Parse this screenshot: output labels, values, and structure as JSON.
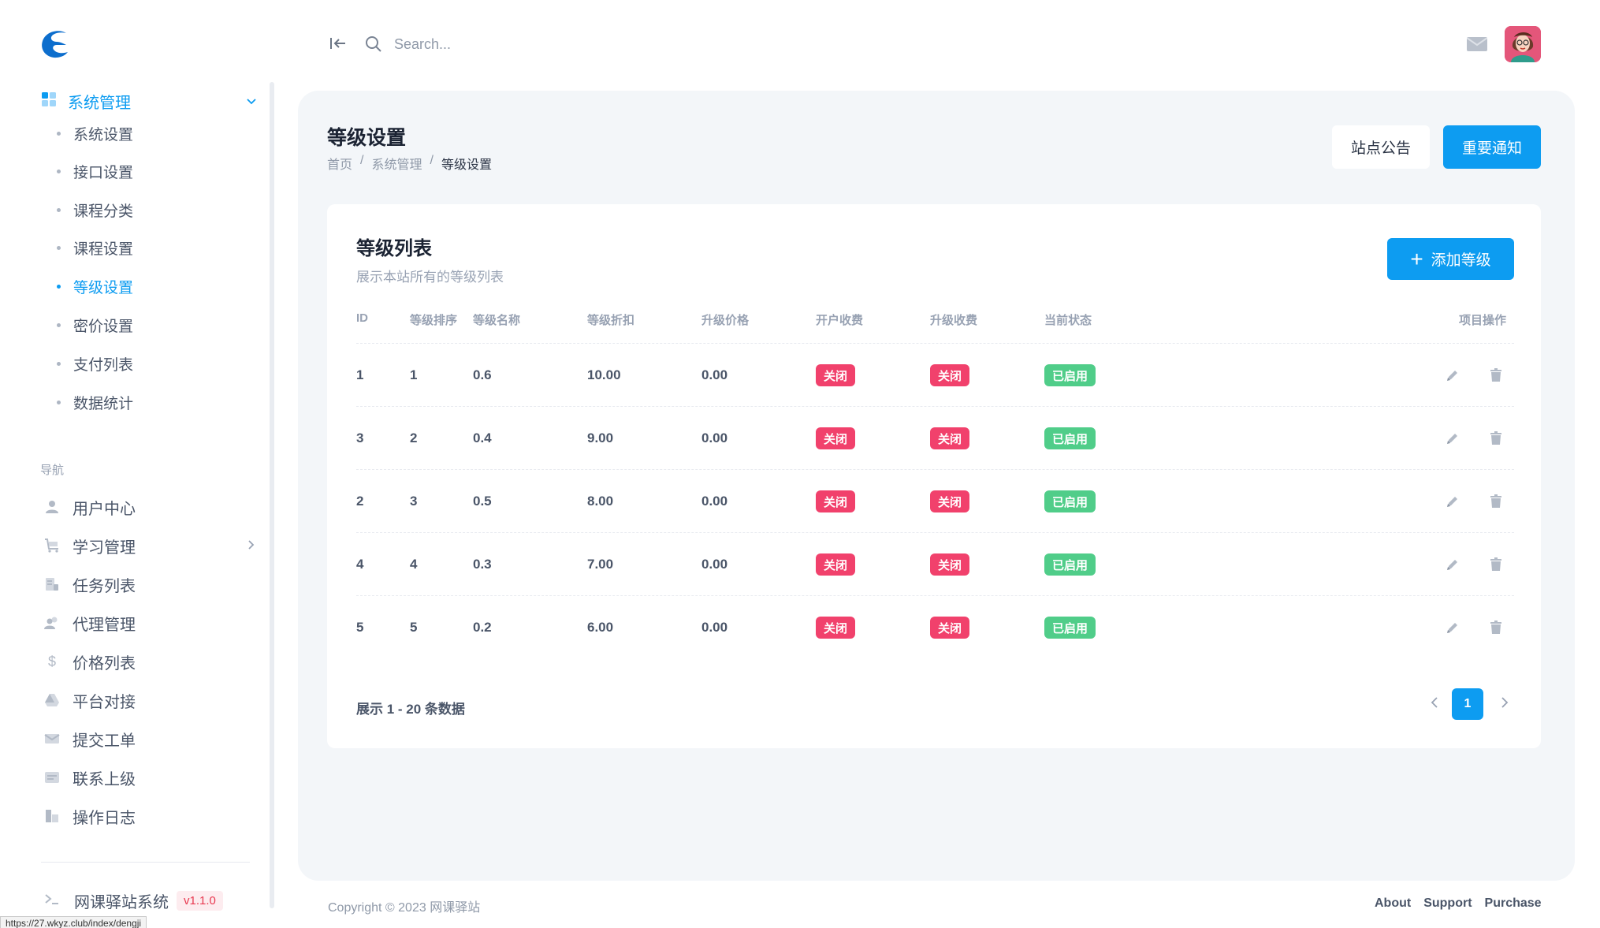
{
  "header": {
    "search_placeholder": "Search..."
  },
  "sidebar": {
    "group": {
      "label": "系统管理",
      "children": [
        "系统设置",
        "接口设置",
        "课程分类",
        "课程设置",
        "等级设置",
        "密价设置",
        "支付列表",
        "数据统计"
      ],
      "active_index": 4
    },
    "section_label": "导航",
    "items": [
      {
        "label": "用户中心",
        "icon": "user-icon"
      },
      {
        "label": "学习管理",
        "icon": "cart-icon"
      },
      {
        "label": "任务列表",
        "icon": "tasks-icon"
      },
      {
        "label": "代理管理",
        "icon": "agents-icon"
      },
      {
        "label": "价格列表",
        "icon": "dollar-icon",
        "glyph": "$"
      },
      {
        "label": "平台对接",
        "icon": "platform-icon"
      },
      {
        "label": "提交工单",
        "icon": "envelope-icon"
      },
      {
        "label": "联系上级",
        "icon": "message-icon"
      },
      {
        "label": "操作日志",
        "icon": "log-icon"
      }
    ],
    "footer": {
      "label": "网课驿站系统",
      "version": "v1.1.0"
    }
  },
  "status_bar_url": "https://27.wkyz.club/index/dengji",
  "page": {
    "title": "等级设置",
    "breadcrumb": [
      "首页",
      "系统管理",
      "等级设置"
    ],
    "buttons": {
      "notice": "站点公告",
      "important": "重要通知"
    }
  },
  "card": {
    "title": "等级列表",
    "subtitle": "展示本站所有的等级列表",
    "add_button": "添加等级",
    "columns": [
      "ID",
      "等级排序",
      "等级名称",
      "等级折扣",
      "升级价格",
      "开户收费",
      "升级收费",
      "当前状态",
      "项目操作"
    ],
    "rows": [
      {
        "id": "1",
        "sort": "1",
        "name": "0.6",
        "discount": "10.00",
        "price": "0.00",
        "open_fee": "关闭",
        "upgrade_fee": "关闭",
        "status": "已启用"
      },
      {
        "id": "3",
        "sort": "2",
        "name": "0.4",
        "discount": "9.00",
        "price": "0.00",
        "open_fee": "关闭",
        "upgrade_fee": "关闭",
        "status": "已启用"
      },
      {
        "id": "2",
        "sort": "3",
        "name": "0.5",
        "discount": "8.00",
        "price": "0.00",
        "open_fee": "关闭",
        "upgrade_fee": "关闭",
        "status": "已启用"
      },
      {
        "id": "4",
        "sort": "4",
        "name": "0.3",
        "discount": "7.00",
        "price": "0.00",
        "open_fee": "关闭",
        "upgrade_fee": "关闭",
        "status": "已启用"
      },
      {
        "id": "5",
        "sort": "5",
        "name": "0.2",
        "discount": "6.00",
        "price": "0.00",
        "open_fee": "关闭",
        "upgrade_fee": "关闭",
        "status": "已启用"
      }
    ],
    "pager": {
      "info": "展示 1 - 20 条数据",
      "current_page": "1"
    }
  },
  "footer": {
    "copyright": "Copyright © 2023 网课驿站",
    "links": [
      "About",
      "Support",
      "Purchase"
    ]
  },
  "colors": {
    "accent": "#0d9cf1",
    "danger": "#f1416c",
    "success": "#50cd89",
    "panel_bg": "#f3f6f9"
  }
}
